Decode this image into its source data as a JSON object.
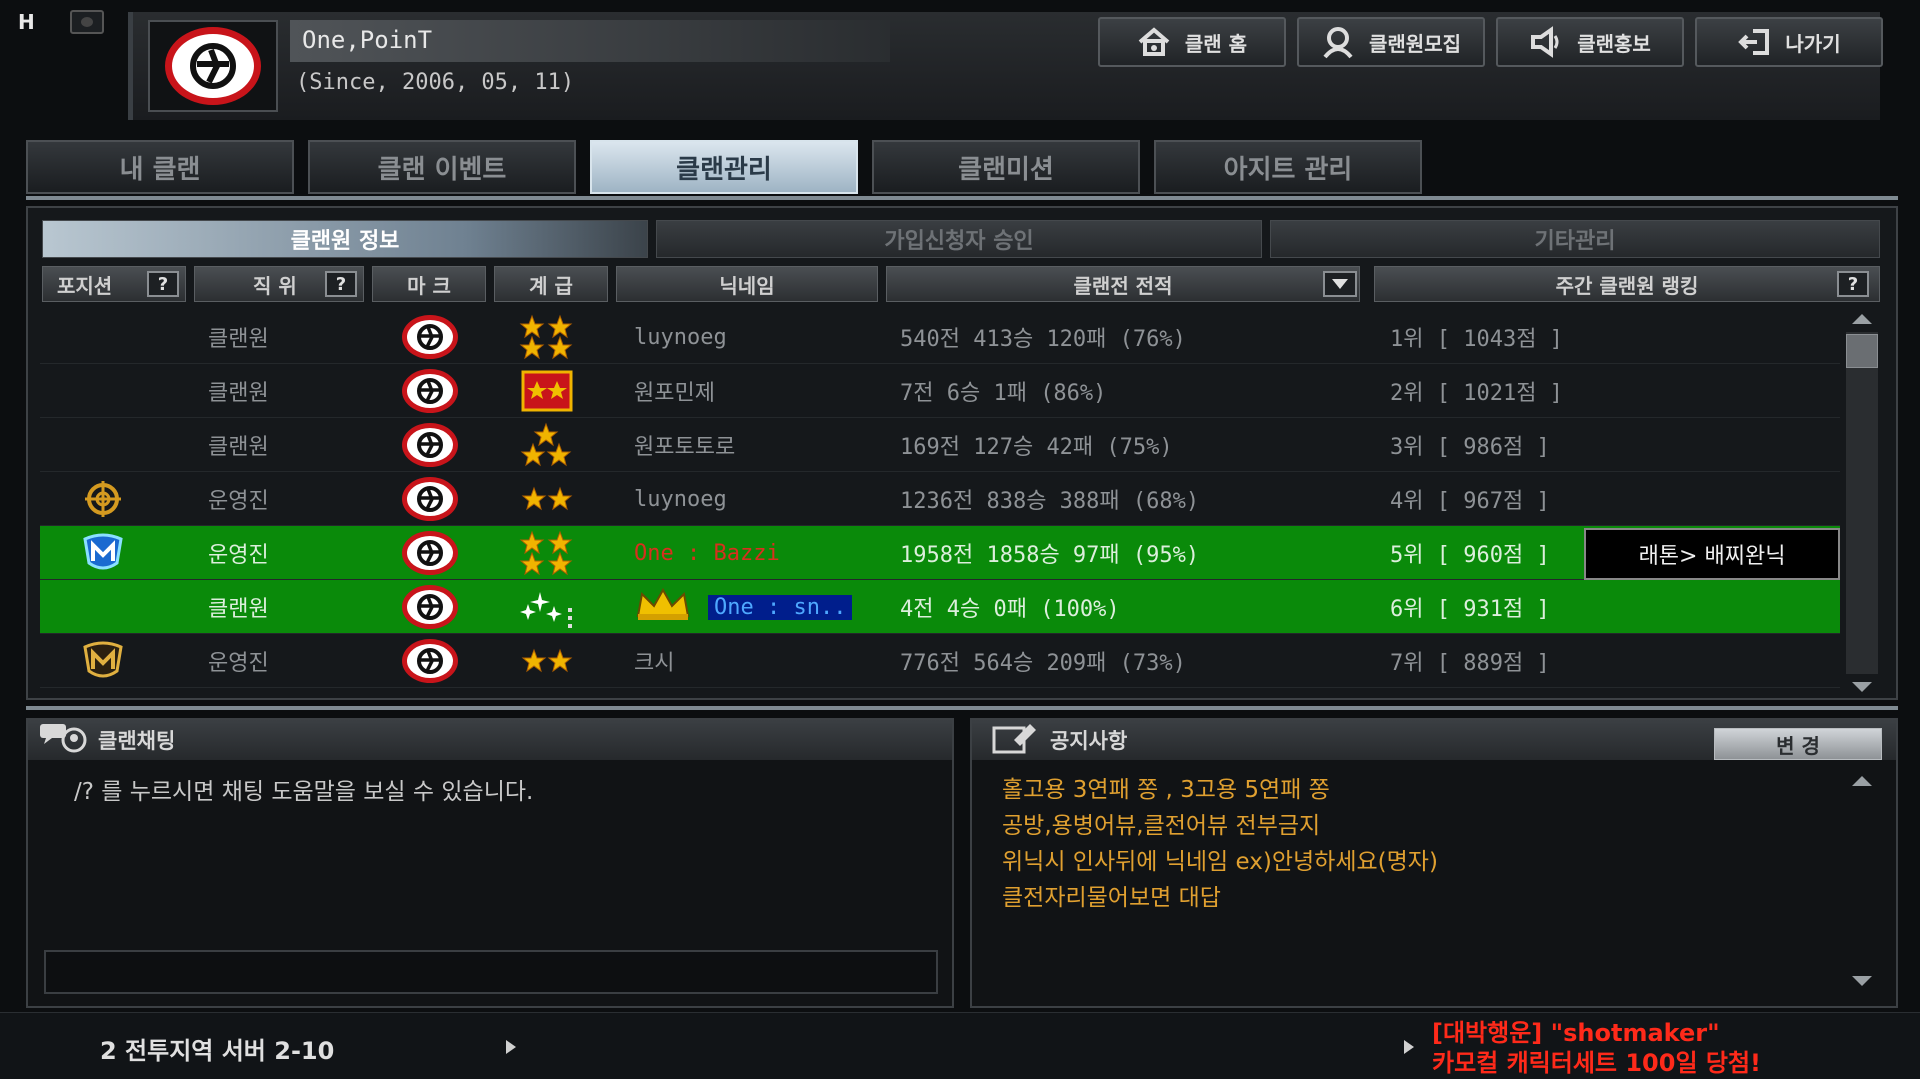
{
  "window": {
    "corner_label": "H"
  },
  "clan": {
    "name": "One,PoinT",
    "since": "(Since, 2006, 05, 11)"
  },
  "top_buttons": [
    {
      "label": "클랜 홈",
      "icon": "home-icon"
    },
    {
      "label": "클랜원모집",
      "icon": "recruit-icon"
    },
    {
      "label": "클랜홍보",
      "icon": "megaphone-icon"
    },
    {
      "label": "나가기",
      "icon": "exit-icon"
    }
  ],
  "main_tabs": [
    {
      "label": "내 클랜",
      "active": false
    },
    {
      "label": "클랜 이벤트",
      "active": false
    },
    {
      "label": "클랜관리",
      "active": true
    },
    {
      "label": "클랜미션",
      "active": false
    },
    {
      "label": "아지트 관리",
      "active": false
    }
  ],
  "sub_tabs": [
    {
      "label": "클랜원 정보",
      "active": true
    },
    {
      "label": "가입신청자 승인",
      "active": false
    },
    {
      "label": "기타관리",
      "active": false
    }
  ],
  "columns": {
    "position": "포지션",
    "role": "직 위",
    "mark": "마 크",
    "rank": "계 급",
    "nickname": "닉네임",
    "record": "클랜전 전적",
    "weekly_ranking": "주간 클랜원 랭킹",
    "help": "?"
  },
  "members": [
    {
      "position_icon": "",
      "role": "클랜원",
      "rank_icon": "four-stars-icon",
      "nickname": "luynoeg",
      "record": "540전 413승 120패 (76%)",
      "ranking": "1위 [ 1043점 ]",
      "highlight": false
    },
    {
      "position_icon": "",
      "role": "클랜원",
      "rank_icon": "red-two-stars-icon",
      "nickname": "원포민제",
      "record": "7전 6승 1패 (86%)",
      "ranking": "2위 [ 1021점 ]",
      "highlight": false
    },
    {
      "position_icon": "",
      "role": "클랜원",
      "rank_icon": "three-stars-icon",
      "nickname": "원포토토로",
      "record": "169전 127승 42패 (75%)",
      "ranking": "3위 [ 986점 ]",
      "highlight": false
    },
    {
      "position_icon": "crosshair-icon",
      "role": "운영진",
      "rank_icon": "two-stars-icon",
      "nickname": "luynoeg",
      "record": "1236전 838승 388패 (68%)",
      "ranking": "4위 [ 967점 ]",
      "highlight": false
    },
    {
      "position_icon": "blue-m-badge-icon",
      "role": "운영진",
      "rank_icon": "four-stars-icon",
      "nickname": "One : Bazzi",
      "record": "1958전 1858승 97패 (95%)",
      "ranking": "5위 [ 960점 ]",
      "highlight": true
    },
    {
      "position_icon": "",
      "role": "클랜원",
      "rank_icon": "sparkle-stars-icon",
      "nickname": "One : sn..",
      "record": "4전 4승 0패 (100%)",
      "ranking": "6위 [ 931점 ]",
      "highlight": true
    },
    {
      "position_icon": "gold-m-badge-icon",
      "role": "운영진",
      "rank_icon": "two-stars-icon",
      "nickname": "크시",
      "record": "776전 564승 209패 (73%)",
      "ranking": "7위 [ 889점 ]",
      "highlight": false
    }
  ],
  "tooltip": "래톤> 배찌완닉",
  "chat": {
    "title": "클랜채팅",
    "message": "/? 를 누르시면 채팅 도움말을 보실 수 있습니다."
  },
  "notice": {
    "title": "공지사항",
    "change_label": "변 경",
    "lines": [
      "홀고용 3연패 쫑 , 3고용 5연패 쫑",
      "공방,용병어뷰,클전어뷰 전부금지",
      "위닉시 인사뒤에 닉네임 ex)안녕하세요(명자)",
      "클전자리물어보면 대답"
    ]
  },
  "status": {
    "server": "2 전투지역 서버 2-10",
    "ticker_line1": "[대박행운] \"shotmaker\"",
    "ticker_line2": "카모컬 캐릭터세트 100일 당첨!"
  },
  "colors": {
    "highlight_row": "#0a8a0a",
    "emblem_red": "#c8141a",
    "notice_text": "#e0a030",
    "ticker_red": "#ff2a1a"
  }
}
